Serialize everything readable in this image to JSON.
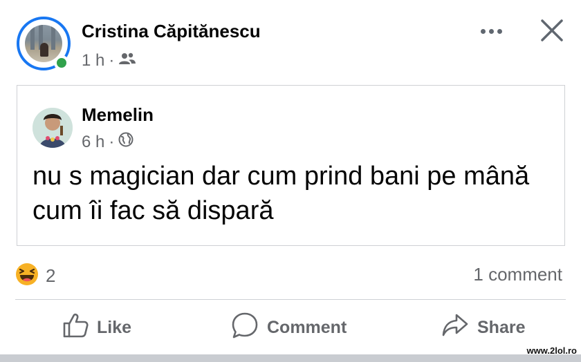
{
  "post": {
    "author": "Cristina Căpitănescu",
    "time": "1 h",
    "separator": "·",
    "audience_icon": "friends-icon"
  },
  "shared": {
    "author": "Memelin",
    "time": "6 h",
    "separator": "·",
    "audience_icon": "globe-icon",
    "text": "nu s magician dar cum prind bani pe mână cum îi fac să dispară"
  },
  "reactions": {
    "icon": "haha-reaction-icon",
    "count": "2",
    "comments": "1 comment"
  },
  "actions": {
    "like": "Like",
    "comment": "Comment",
    "share": "Share"
  },
  "watermark": "www.2lol.ro",
  "colors": {
    "story_ring": "#1877f2",
    "online": "#31a24c",
    "secondary_text": "#65676b",
    "reaction_yellow": "#f7b125"
  }
}
